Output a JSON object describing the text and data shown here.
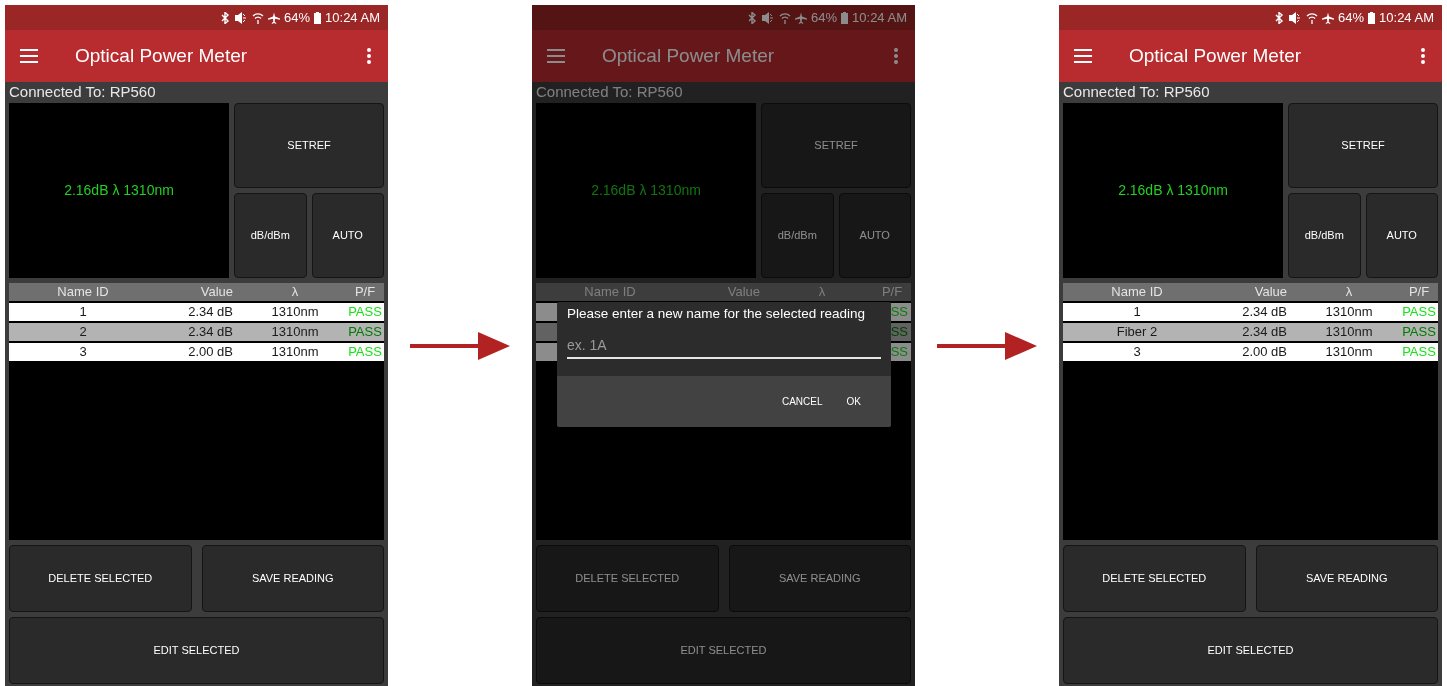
{
  "screens": [
    {
      "status_bar": {
        "battery": "64%",
        "time": "10:24 AM"
      },
      "app_bar": {
        "title": "Optical Power Meter"
      },
      "connected": "Connected To: RP560",
      "display": "2.16dB λ 1310nm",
      "controls": [
        "SETREF",
        "dB/dBm",
        "AUTO"
      ],
      "table": {
        "columns": [
          "Name ID",
          "Value",
          "λ",
          "P/F"
        ],
        "rows": [
          {
            "name": "1",
            "value": "2.34 dB",
            "wavelength": "1310nm",
            "pf": "PASS",
            "selected": false
          },
          {
            "name": "2",
            "value": "2.34 dB",
            "wavelength": "1310nm",
            "pf": "PASS",
            "selected": true
          },
          {
            "name": "3",
            "value": "2.00 dB",
            "wavelength": "1310nm",
            "pf": "PASS",
            "selected": false
          }
        ]
      },
      "bottom_buttons": [
        "DELETE SELECTED",
        "SAVE READING",
        "EDIT SELECTED"
      ],
      "dimmed": false
    },
    {
      "status_bar": {
        "battery": "64%",
        "time": "10:24 AM"
      },
      "app_bar": {
        "title": "Optical Power Meter"
      },
      "connected": "Connected To: RP560",
      "display": "2.16dB λ 1310nm",
      "controls": [
        "SETREF",
        "dB/dBm",
        "AUTO"
      ],
      "table": {
        "columns": [
          "Name ID",
          "Value",
          "λ",
          "P/F"
        ],
        "rows": [
          {
            "pf": "SS",
            "selected": false
          },
          {
            "pf": "SS",
            "selected": true
          },
          {
            "pf": "SS",
            "selected": false
          }
        ]
      },
      "bottom_buttons": [
        "DELETE SELECTED",
        "SAVE READING",
        "EDIT SELECTED"
      ],
      "dimmed": true,
      "dialog": {
        "title": "Please enter a new name for the selected reading",
        "placeholder": "ex. 1A",
        "buttons": [
          "CANCEL",
          "OK"
        ]
      }
    },
    {
      "status_bar": {
        "battery": "64%",
        "time": "10:24 AM"
      },
      "app_bar": {
        "title": "Optical Power Meter"
      },
      "connected": "Connected To: RP560",
      "display": "2.16dB λ 1310nm",
      "controls": [
        "SETREF",
        "dB/dBm",
        "AUTO"
      ],
      "table": {
        "columns": [
          "Name ID",
          "Value",
          "λ",
          "P/F"
        ],
        "rows": [
          {
            "name": "1",
            "value": "2.34 dB",
            "wavelength": "1310nm",
            "pf": "PASS",
            "selected": false
          },
          {
            "name": "Fiber 2",
            "value": "2.34 dB",
            "wavelength": "1310nm",
            "pf": "PASS",
            "selected": true
          },
          {
            "name": "3",
            "value": "2.00 dB",
            "wavelength": "1310nm",
            "pf": "PASS",
            "selected": false
          }
        ]
      },
      "bottom_buttons": [
        "DELETE SELECTED",
        "SAVE READING",
        "EDIT SELECTED"
      ],
      "dimmed": false
    }
  ]
}
